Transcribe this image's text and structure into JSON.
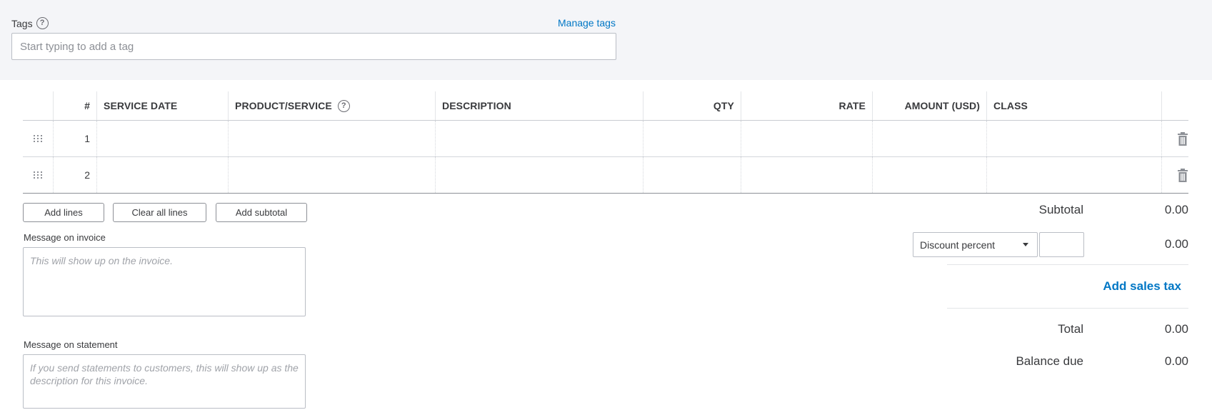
{
  "tags": {
    "label": "Tags",
    "manage_link": "Manage tags",
    "input_placeholder": "Start typing to add a tag"
  },
  "table": {
    "columns": {
      "num": "#",
      "service_date": "SERVICE DATE",
      "product_service": "PRODUCT/SERVICE",
      "description": "DESCRIPTION",
      "qty": "QTY",
      "rate": "RATE",
      "amount": "AMOUNT (USD)",
      "class": "CLASS"
    },
    "rows": [
      {
        "num": "1",
        "service_date": "",
        "product_service": "",
        "description": "",
        "qty": "",
        "rate": "",
        "amount": "",
        "class": ""
      },
      {
        "num": "2",
        "service_date": "",
        "product_service": "",
        "description": "",
        "qty": "",
        "rate": "",
        "amount": "",
        "class": ""
      }
    ]
  },
  "actions": {
    "add_lines": "Add lines",
    "clear_all_lines": "Clear all lines",
    "add_subtotal": "Add subtotal"
  },
  "messages": {
    "invoice_label": "Message on invoice",
    "invoice_placeholder": "This will show up on the invoice.",
    "statement_label": "Message on statement",
    "statement_placeholder": "If you send statements to customers, this will show up as the description for this invoice."
  },
  "totals": {
    "subtotal_label": "Subtotal",
    "subtotal_value": "0.00",
    "discount_type": "Discount percent",
    "discount_value": "0.00",
    "add_sales_tax": "Add sales tax",
    "total_label": "Total",
    "total_value": "0.00",
    "balance_due_label": "Balance due",
    "balance_due_value": "0.00"
  },
  "colors": {
    "link": "#0077c5",
    "band": "#f4f5f8",
    "text": "#393a3d"
  }
}
